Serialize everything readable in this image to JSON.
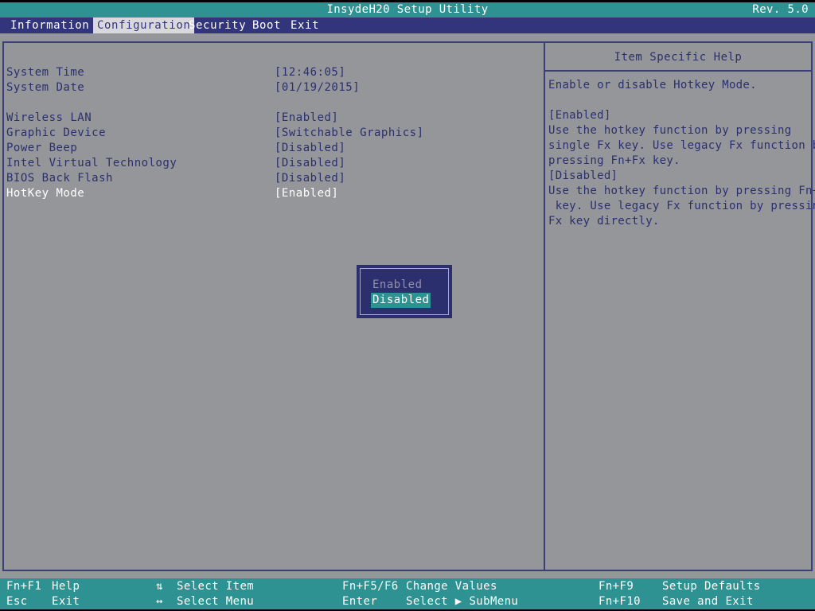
{
  "titlebar": {
    "title": "InsydeH20 Setup Utility",
    "revision": "Rev. 5.0"
  },
  "menu": {
    "items": [
      {
        "label": "Information",
        "active": false
      },
      {
        "label": "Configuration",
        "active": true
      },
      {
        "label": "Security",
        "active": false
      },
      {
        "label": "Boot",
        "active": false
      },
      {
        "label": "Exit",
        "active": false
      }
    ]
  },
  "settings": [
    {
      "label": "System Time",
      "value": "[12:46:05]",
      "selected": false
    },
    {
      "label": "System Date",
      "value": "[01/19/2015]",
      "selected": false
    },
    {
      "label": "Wireless LAN",
      "value": "[Enabled]",
      "selected": false
    },
    {
      "label": "Graphic Device",
      "value": "[Switchable Graphics]",
      "selected": false
    },
    {
      "label": "Power Beep",
      "value": "[Disabled]",
      "selected": false
    },
    {
      "label": "Intel Virtual Technology",
      "value": "[Disabled]",
      "selected": false
    },
    {
      "label": "BIOS Back Flash",
      "value": "[Disabled]",
      "selected": false
    },
    {
      "label": "HotKey Mode",
      "value": "[Enabled]",
      "selected": true
    }
  ],
  "help": {
    "title": "Item Specific Help",
    "lines": [
      "Enable or disable Hotkey Mode.",
      "",
      "[Enabled]",
      "Use the hotkey function by pressing",
      "single Fx key. Use legacy Fx function by",
      "pressing Fn+Fx key.",
      "[Disabled]",
      "Use the hotkey function by pressing Fn+Fx",
      " key. Use legacy Fx function by pressing",
      "Fx key directly."
    ]
  },
  "dropdown": {
    "options": [
      {
        "label": "Enabled",
        "highlighted": false
      },
      {
        "label": "Disabled",
        "highlighted": true
      }
    ]
  },
  "bottom_bar": {
    "hints": [
      {
        "key": "Fn+F1",
        "desc": "Help"
      },
      {
        "key": "Esc",
        "desc": "Exit"
      },
      {
        "key": "⇅",
        "desc": "Select Item"
      },
      {
        "key": "↔",
        "desc": "Select Menu"
      },
      {
        "key": "Fn+F5/F6",
        "desc": "Change Values"
      },
      {
        "key": "Enter",
        "desc": "Select ▶ SubMenu"
      },
      {
        "key": "Fn+F9",
        "desc": "Setup Defaults"
      },
      {
        "key": "Fn+F10",
        "desc": "Save and Exit"
      }
    ]
  },
  "colors": {
    "teal": "#2e9292",
    "menu_blue": "#32357c",
    "background_gray": "#959699",
    "text_navy": "#2b2f6e",
    "selected_white": "#ffffff",
    "popup_navy": "#2b2f6e",
    "popup_dim_text": "#8f90ab",
    "border_navy": "#3a3f78"
  }
}
